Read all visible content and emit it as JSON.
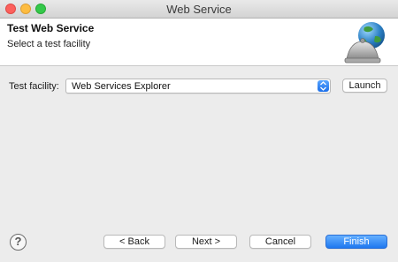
{
  "window": {
    "title": "Web Service"
  },
  "banner": {
    "title": "Test Web Service",
    "subtitle": "Select a test facility",
    "icon": "globe-bell-icon"
  },
  "form": {
    "facility_label": "Test facility:",
    "facility_value": "Web Services Explorer",
    "launch_label": "Launch"
  },
  "footer": {
    "help_glyph": "?",
    "back_label": "< Back",
    "next_label": "Next >",
    "cancel_label": "Cancel",
    "finish_label": "Finish"
  },
  "colors": {
    "accent": "#1f78ef",
    "close": "#fc605c",
    "minimize": "#fdbc40",
    "maximize": "#34c84a"
  }
}
